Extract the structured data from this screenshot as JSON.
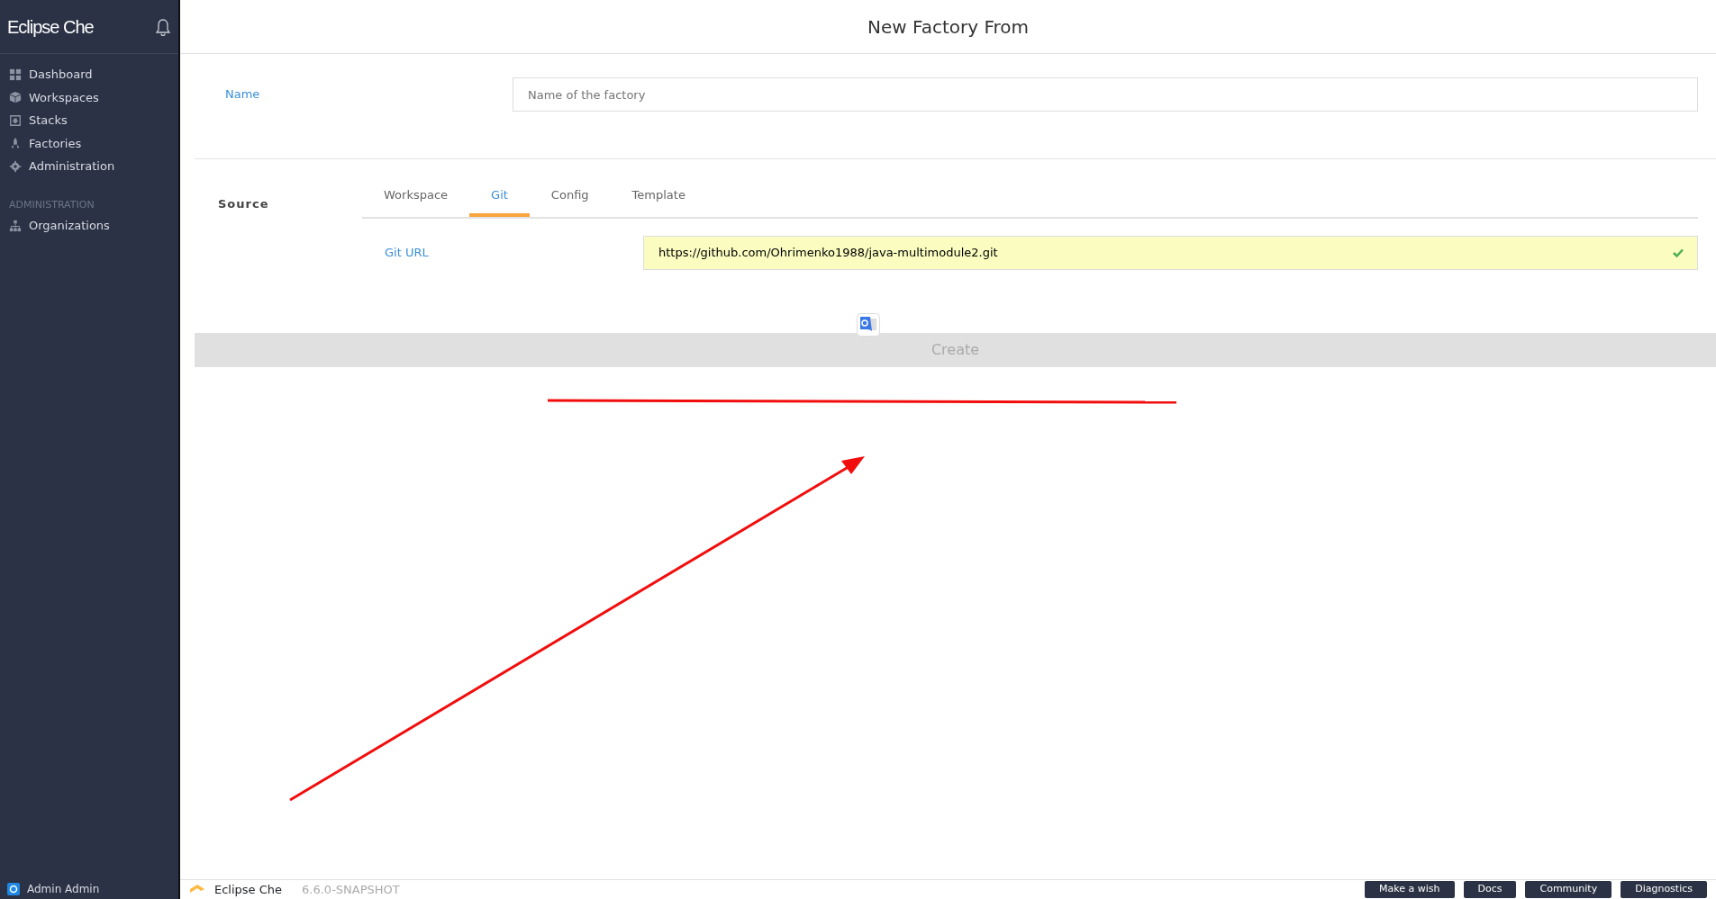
{
  "sidebar": {
    "brand": "Eclipse Che",
    "items": [
      {
        "label": "Dashboard",
        "kind": "grid"
      },
      {
        "label": "Workspaces",
        "kind": "cube"
      },
      {
        "label": "Stacks",
        "kind": "box"
      },
      {
        "label": "Factories",
        "kind": "rocket"
      },
      {
        "label": "Administration",
        "kind": "gear"
      }
    ],
    "section": "ADMINISTRATION",
    "section_items": [
      {
        "label": "Organizations",
        "kind": "tree"
      }
    ],
    "user": "Admin Admin"
  },
  "page": {
    "title": "New Factory From",
    "name_label": "Name",
    "name_placeholder": "Name of the factory",
    "source_label": "Source",
    "tabs": [
      {
        "label": "Workspace",
        "selected": false
      },
      {
        "label": "Git",
        "selected": true
      },
      {
        "label": "Config",
        "selected": false
      },
      {
        "label": "Template",
        "selected": false
      }
    ],
    "git_url_label": "Git URL",
    "git_url": "https://github.com/Ohrimenko1988/java-multimodule2.git",
    "valid": true,
    "create": {
      "label": "Create",
      "disabled": true
    }
  },
  "footer": {
    "product": "Eclipse Che",
    "version": "6.6.0-SNAPSHOT",
    "buttons": [
      "Make a wish",
      "Docs",
      "Community",
      "Diagnostics"
    ]
  }
}
